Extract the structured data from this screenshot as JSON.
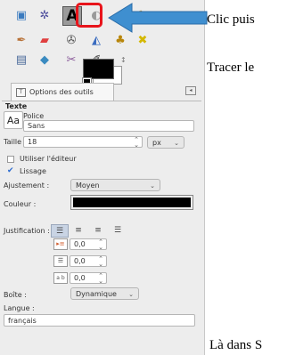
{
  "annotations": {
    "line1": "Clic puis",
    "line2": "Tracer le",
    "line3": "Là dans S"
  },
  "toolbox": {
    "tools": [
      {
        "icon": "rect-select-icon",
        "glyph": "▣",
        "color": "#3a7bbf"
      },
      {
        "icon": "fuzzy-select-icon",
        "glyph": "✲",
        "color": "#4a4a9a"
      },
      {
        "icon": "text-tool-icon",
        "glyph": "A",
        "color": "#000000",
        "active": true
      },
      {
        "icon": "heal-icon",
        "glyph": "◐",
        "color": "#9a9a9a"
      },
      {
        "icon": "clone-icon",
        "glyph": "▭",
        "color": "#777777"
      },
      {
        "icon": "pencil-icon",
        "glyph": "✎",
        "color": "#c0892a"
      },
      {
        "icon": "paintbrush-icon",
        "glyph": "✒",
        "color": "#b8733a"
      },
      {
        "icon": "eraser-icon",
        "glyph": "▰",
        "color": "#e04040"
      },
      {
        "icon": "airbrush-icon",
        "glyph": "✇",
        "color": "#555555"
      },
      {
        "icon": "bucket-fill-icon",
        "glyph": "◭",
        "color": "#3a6cc0"
      },
      {
        "icon": "stamp-icon",
        "glyph": "♣",
        "color": "#b8860b"
      },
      {
        "icon": "heal-patch-icon",
        "glyph": "✖",
        "color": "#d4b800"
      },
      {
        "icon": "perspective-clone-icon",
        "glyph": "▤",
        "color": "#4a6a9a"
      },
      {
        "icon": "blur-icon",
        "glyph": "◆",
        "color": "#3a8ac0"
      },
      {
        "icon": "smudge-icon",
        "glyph": "✂",
        "color": "#8a5a9a"
      },
      {
        "icon": "dodge-burn-icon",
        "glyph": "✐",
        "color": "#333333"
      }
    ],
    "fg_color": "#000000",
    "bg_color": "#ffffff"
  },
  "options": {
    "tab_label": "Options des outils",
    "section_title": "Texte",
    "font_label": "Police",
    "font_preview": "Aa",
    "font_value": "Sans",
    "size_label": "Taille :",
    "size_value": "18",
    "size_unit": "px",
    "use_editor_label": "Utiliser l'éditeur",
    "use_editor_checked": false,
    "antialias_label": "Lissage",
    "antialias_checked": true,
    "hinting_label": "Ajustement :",
    "hinting_value": "Moyen",
    "color_label": "Couleur :",
    "text_color": "#000000",
    "justify_label": "Justification :",
    "indent_value": "0,0",
    "line_spacing_value": "0,0",
    "letter_spacing_value": "0,0",
    "box_label": "Boîte :",
    "box_value": "Dynamique",
    "language_label": "Langue :",
    "language_value": "français"
  },
  "highlight_color": "#e8141b",
  "arrow_color": "#3f8fd0"
}
